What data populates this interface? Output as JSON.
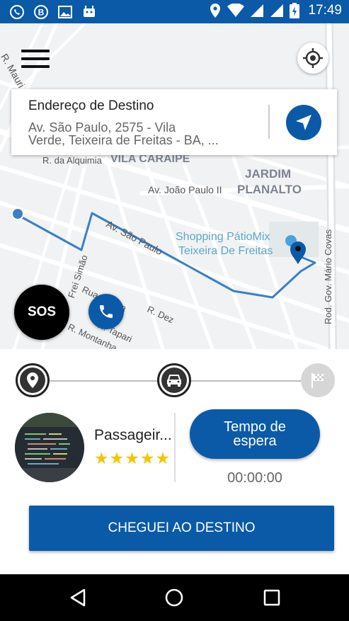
{
  "status_bar": {
    "time": "17:49",
    "left_icons": [
      "whatsapp-icon",
      "b-icon",
      "image-icon",
      "android-icon"
    ],
    "right_icons": [
      "location-icon",
      "wifi-icon",
      "signal-icon",
      "signal-icon",
      "battery-charging-icon"
    ]
  },
  "map": {
    "street_labels": {
      "r_mauri": "R. Mauri",
      "r_alquimia": "R. da Alquimia",
      "vila_caraipe": "VILA CARAIPE",
      "jardim": "JARDIM",
      "planalto": "PLANALTO",
      "av_joao_paulo": "Av. João Paulo II",
      "av_sao_paulo": "Av. São Paulo",
      "shopping_1": "Shopping PátioMix",
      "shopping_2": "Teixeira De Freitas",
      "frei_simao": "Frei Simão",
      "r_dez": "R. Dez",
      "r_montanha": "R. Montanha",
      "rua_marina": "Rua Marina",
      "r_tapari": "R. Tapari",
      "rod_mario": "Rod. Gov. Mário Covas"
    },
    "route_color": "#3b7fc7"
  },
  "destination": {
    "title": "Endereço de Destino",
    "address_line1": "Av. São Paulo, 2575 - Vila",
    "address_line2": "Verde, Teixeira de Freitas - BA, ..."
  },
  "buttons": {
    "sos": "SOS",
    "wait_label": "Tempo de espera",
    "arrive": "CHEGUEI AO DESTINO"
  },
  "progress": {
    "steps": [
      "pickup-pin-icon",
      "car-icon",
      "finish-flag-icon"
    ],
    "current_step": 2
  },
  "passenger": {
    "name": "Passageir...",
    "rating": 5
  },
  "wait_time": "00:00:00",
  "colors": {
    "primary": "#0b5aa8",
    "star": "#f4c400"
  }
}
